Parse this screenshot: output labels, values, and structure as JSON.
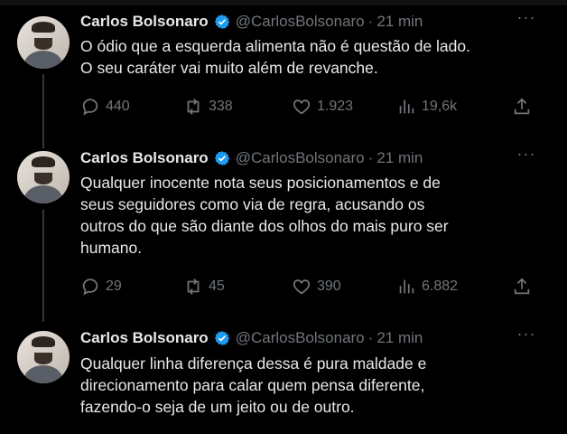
{
  "tweets": [
    {
      "name": "Carlos Bolsonaro",
      "handle": "@CarlosBolsonaro",
      "separator": "·",
      "time": "21 min",
      "lines": [
        "O ódio que a esquerda alimenta não é questão de lado.",
        "O seu caráter vai muito além de revanche."
      ],
      "replies": "440",
      "reposts": "338",
      "likes": "1.923",
      "views": "19,6k"
    },
    {
      "name": "Carlos Bolsonaro",
      "handle": "@CarlosBolsonaro",
      "separator": "·",
      "time": "21 min",
      "lines": [
        "Qualquer inocente nota seus posicionamentos e de",
        "seus seguidores como via de regra, acusando os",
        "outros do que são diante dos olhos do mais puro ser",
        "humano."
      ],
      "replies": "29",
      "reposts": "45",
      "likes": "390",
      "views": "6.882"
    },
    {
      "name": "Carlos Bolsonaro",
      "handle": "@CarlosBolsonaro",
      "separator": "·",
      "time": "21 min",
      "lines": [
        "Qualquer linha diferença dessa é  pura maldade e",
        "direcionamento para calar quem pensa diferente,",
        "fazendo-o seja de um jeito ou de outro."
      ]
    }
  ],
  "icons": {
    "verified": "verified-badge-icon",
    "more": "more-dots-icon",
    "reply": "reply-bubble-icon",
    "repost": "repost-arrows-icon",
    "like": "heart-icon",
    "views": "analytics-bars-icon",
    "share": "share-upload-icon"
  },
  "colors": {
    "background": "#000000",
    "text": "#e7e9ea",
    "muted": "#71767b",
    "verified": "#1d9bf0",
    "thread_line": "#333639"
  }
}
